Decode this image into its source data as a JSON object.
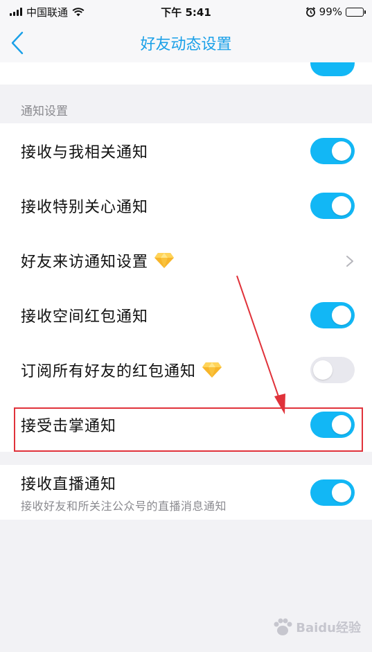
{
  "status_bar": {
    "carrier": "中国联通",
    "time": "下午 5:41",
    "battery_percent": "99%",
    "battery_level": 0.99
  },
  "nav": {
    "title": "好友动态设置"
  },
  "section": {
    "header": "通知设置"
  },
  "notification_rows": [
    {
      "label": "接收与我相关通知",
      "control": "toggle",
      "on": true
    },
    {
      "label": "接收特别关心通知",
      "control": "toggle",
      "on": true
    },
    {
      "label": "好友来访通知设置",
      "control": "chevron",
      "premium": true
    },
    {
      "label": "接收空间红包通知",
      "control": "toggle",
      "on": true
    },
    {
      "label": "订阅所有好友的红包通知",
      "control": "toggle",
      "on": false,
      "premium": true
    },
    {
      "label": "接受击掌通知",
      "control": "toggle",
      "on": true
    }
  ],
  "live_row": {
    "title": "接收直播通知",
    "subtitle": "接收好友和所关注公众号的直播消息通知",
    "on": true
  },
  "watermark": {
    "text": "Baidu经验"
  },
  "colors": {
    "accent": "#12b7f5",
    "title_blue": "#1aa0e8",
    "annotation_red": "#e0323a"
  }
}
